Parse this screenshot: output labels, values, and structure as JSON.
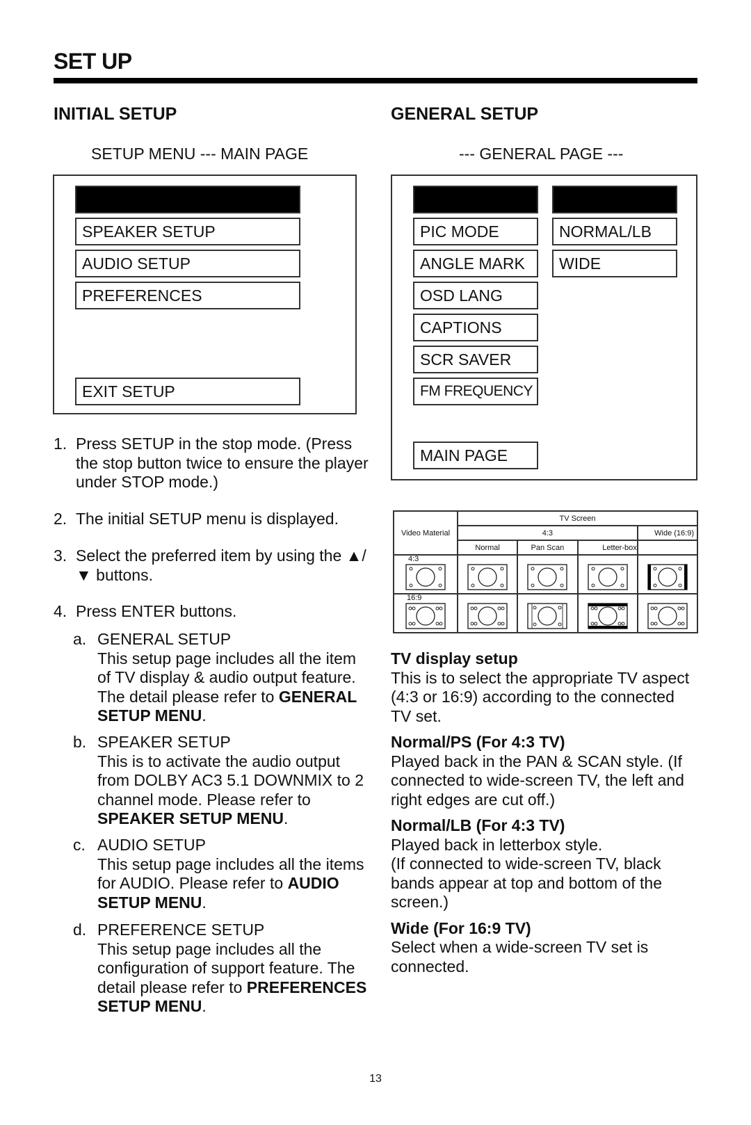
{
  "page_title": "SET UP",
  "page_number": "13",
  "initial_setup": {
    "heading": "INITIAL SETUP",
    "menu_caption": "SETUP MENU --- MAIN PAGE",
    "menu_items": [
      "",
      "SPEAKER SETUP",
      "AUDIO SETUP",
      "PREFERENCES",
      "EXIT SETUP"
    ],
    "steps": [
      {
        "num": "1.",
        "text": "Press SETUP in the stop mode. (Press the stop button twice to ensure the player under STOP mode.)"
      },
      {
        "num": "2.",
        "text": "The initial SETUP menu is displayed."
      },
      {
        "num": "3.",
        "text": "Select the preferred item by using the ▲/▼ buttons."
      },
      {
        "num": "4.",
        "text": "Press ENTER buttons."
      }
    ],
    "sub_items": [
      {
        "letter": "a.",
        "title": "GENERAL SETUP",
        "text": "This setup page includes all the item of TV display & audio output feature.  The detail please refer to",
        "ref": "GENERAL SETUP MENU",
        "end": "."
      },
      {
        "letter": "b.",
        "title": "SPEAKER SETUP",
        "text": "This is to activate the audio output from DOLBY AC3 5.1 DOWNMIX to 2 channel mode.  Please refer to",
        "ref": "SPEAKER SETUP MENU",
        "end": "."
      },
      {
        "letter": "c.",
        "title": "AUDIO SETUP",
        "text": "This setup page includes all the items for AUDIO.  Please refer to",
        "ref": "AUDIO SETUP MENU",
        "end": "."
      },
      {
        "letter": "d.",
        "title": "PREFERENCE SETUP",
        "text": "This setup page includes all the configuration of support feature. The detail please refer to",
        "ref": "PREFERENCES SETUP MENU",
        "end": "."
      }
    ]
  },
  "general_setup": {
    "heading": "GENERAL SETUP",
    "menu_caption": "--- GENERAL PAGE ---",
    "left_items": [
      "",
      "PIC MODE",
      "ANGLE MARK",
      "OSD LANG",
      "CAPTIONS",
      "SCR SAVER",
      "FM FREQUENCY",
      "MAIN PAGE"
    ],
    "right_items": [
      "",
      "NORMAL/LB",
      "WIDE"
    ],
    "tv_table": {
      "video_material": "Video Material",
      "tv_screen": "TV Screen",
      "ratio_43": "4:3",
      "wide": "Wide (16:9)",
      "modes": [
        "Normal",
        "Pan Scan",
        "Letter-box"
      ],
      "rows": [
        "4:3",
        "16:9"
      ]
    },
    "sections": [
      {
        "heading": "TV display setup",
        "text": "This is to select the appropriate TV aspect (4:3 or 16:9) according to the connected TV set."
      },
      {
        "heading": "Normal/PS (For 4:3 TV)",
        "text": "Played back in the PAN & SCAN style. (If connected to wide-screen TV, the left and right edges are cut off.)"
      },
      {
        "heading": "Normal/LB (For 4:3 TV)",
        "text": "Played back in letterbox style.\n(If connected to wide-screen TV, black bands appear at top and bottom of the screen.)"
      },
      {
        "heading": "Wide (For 16:9 TV)",
        "text": "Select when a wide-screen TV set is connected."
      }
    ]
  }
}
